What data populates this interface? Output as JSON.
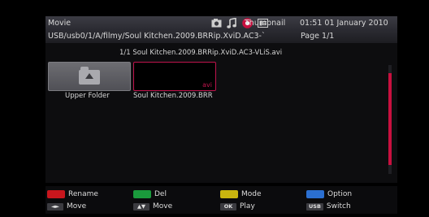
{
  "header": {
    "mode_title": "Movie",
    "view_mode": "Thumbnail",
    "clock": "01:51 01 January 2010",
    "path": "USB/usb0/1/A/filmy/Soul Kitchen.2009.BRRip.XviD.AC3-`",
    "page": "Page 1/1",
    "icons": [
      "photo-icon",
      "music-icon",
      "movie-icon",
      "text-icon"
    ]
  },
  "file_info": "1/1 Soul Kitchen.2009.BRRip.XviD.AC3-VLiS.avi",
  "items": [
    {
      "label": "Upper Folder",
      "type": "folder"
    },
    {
      "label": "Soul Kitchen.2009.BRR",
      "type": "file",
      "ext": "avi"
    }
  ],
  "footer": {
    "color_keys": [
      {
        "label": "Rename",
        "color": "#c8161d"
      },
      {
        "label": "Del",
        "color": "#1a9a3c"
      },
      {
        "label": "Mode",
        "color": "#c9b40f"
      },
      {
        "label": "Option",
        "color": "#2b6fd0"
      }
    ],
    "nav_keys": [
      {
        "key": "◄►",
        "label": "Move"
      },
      {
        "key": "▲▼",
        "label": "Move"
      },
      {
        "key": "OK",
        "label": "Play"
      },
      {
        "key": "USB",
        "label": "Switch"
      }
    ]
  },
  "colors": {
    "accent": "#c8103f",
    "header_bg": "#3c3c44"
  }
}
